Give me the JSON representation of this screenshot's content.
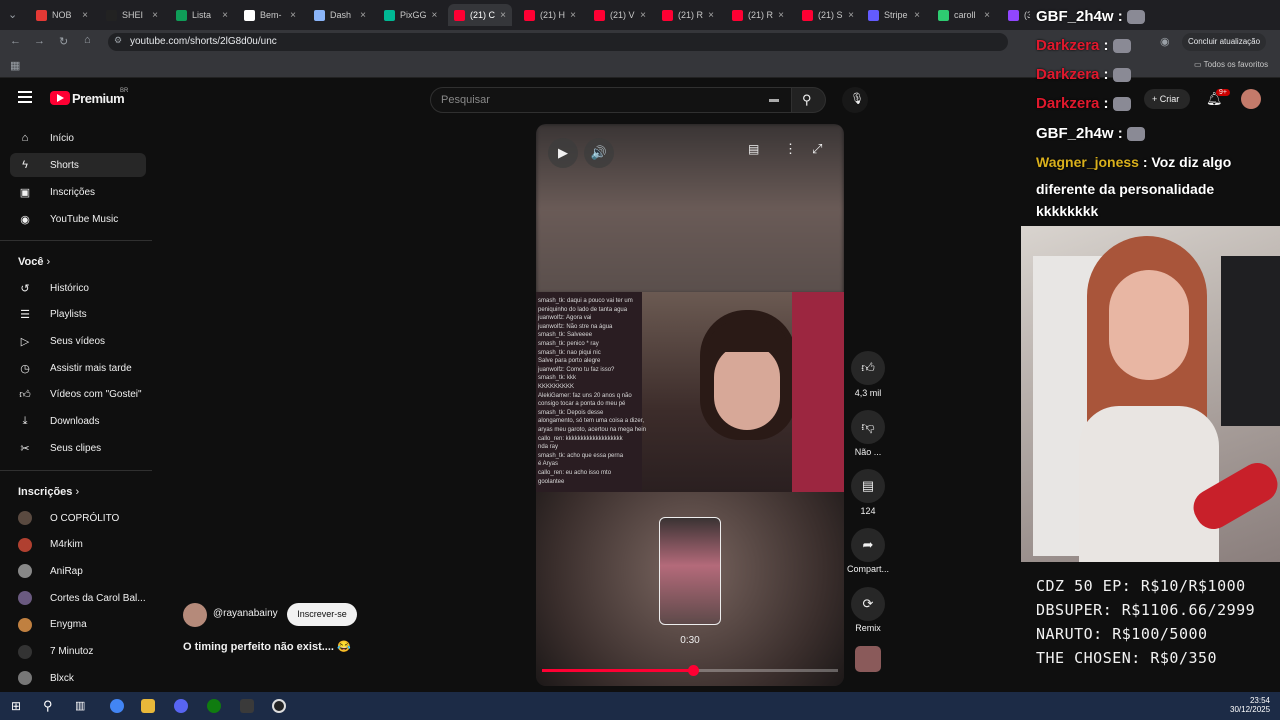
{
  "browser": {
    "tabs": [
      "NOB",
      "SHEI",
      "Lista",
      "Bem-",
      "Dash",
      "PixGG",
      "(21) C",
      "(21) H",
      "(21) V",
      "(21) R",
      "(21) R",
      "(21) S",
      "Stripe",
      "caroll",
      "(3) c"
    ],
    "url": "youtube.com/shorts/2lG8d0u/unc",
    "update_label": "Concluir atualização",
    "favorites_label": "Todos os favoritos"
  },
  "yt": {
    "logo": "Premium",
    "region": "BR",
    "search_placeholder": "Pesquisar",
    "create_label": "Criar",
    "notif_count": "9+"
  },
  "sidebar": {
    "main": [
      {
        "label": "Início",
        "icon": "home-icon"
      },
      {
        "label": "Shorts",
        "icon": "shorts-icon"
      },
      {
        "label": "Inscrições",
        "icon": "subscriptions-icon"
      },
      {
        "label": "YouTube Music",
        "icon": "music-icon"
      }
    ],
    "you_title": "Você",
    "you": [
      {
        "label": "Histórico",
        "icon": "history-icon"
      },
      {
        "label": "Playlists",
        "icon": "playlist-icon"
      },
      {
        "label": "Seus vídeos",
        "icon": "video-icon"
      },
      {
        "label": "Assistir mais tarde",
        "icon": "watch-later-icon"
      },
      {
        "label": "Vídeos com \"Gostei\"",
        "icon": "like-icon"
      },
      {
        "label": "Downloads",
        "icon": "download-icon"
      },
      {
        "label": "Seus clipes",
        "icon": "scissors-icon"
      }
    ],
    "subs_title": "Inscrições",
    "subs": [
      "O COPRÓLITO",
      "M4rkim",
      "AniRap",
      "Cortes da Carol Bal...",
      "Enygma",
      "7 Minutoz",
      "Blxck"
    ]
  },
  "short": {
    "channel": "@rayanabainy",
    "subscribe": "Inscrever-se",
    "title": "O timing perfeito não exist.... 😂",
    "thumb_time": "0:30",
    "progress_fraction": 0.51,
    "likes": "4,3 mil",
    "dislike_label": "Não ...",
    "comments": "124",
    "share_label": "Compart...",
    "remix_label": "Remix"
  },
  "chat_in_video": [
    "smash_tk: daqui a pouco vai ter um",
    "peniquinho do lado de tanta agua",
    "juanwolfz: Agora vai",
    "juanwolfz: Não stre na água",
    "smash_tk: Salveeee",
    "smash_tk: penico * ray",
    "smash_tk: nao piqui nic",
    "Salve para porto alegre",
    "juanwolfz: Como tu faz isso?",
    "smash_tk: kkk",
    "KKKKKKKKK",
    "AlekiGamer: faz uns 20 anos q não",
    "consigo tocar a ponta do meu pé",
    "smash_tk: Depois desse",
    "alongamento, só tem uma coisa a dizer,",
    "aryas meu garoto, acertou na mega hein",
    "callo_ren: kkkkkkkkkkkkkkkkkkk",
    "nda ray",
    "smash_tk: acho que essa perna",
    "é Aryas",
    "callo_ren: eu acho isso mto",
    "goolantee"
  ],
  "stream": {
    "chat": [
      {
        "user": "GBF_2h4w",
        "msg": "",
        "color": "#ffffff"
      },
      {
        "user": "Darkzera",
        "msg": "",
        "color": "#e0192d"
      },
      {
        "user": "Darkzera",
        "msg": "",
        "color": "#e0192d"
      },
      {
        "user": "Darkzera",
        "msg": "",
        "color": "#e0192d"
      },
      {
        "user": "GBF_2h4w",
        "msg": "",
        "color": "#ffffff"
      },
      {
        "user": "Wagner_joness",
        "msg": "Voz diz algo",
        "color": "#d9b01c"
      }
    ],
    "msg_cont1": "diferente da personalidade",
    "msg_cont2": "kkkkkkkk",
    "goals": [
      "CDZ 50 EP: R$10/R$1000",
      "DBSUPER: R$1106.66/2999",
      "NARUTO: R$100/5000",
      "THE CHOSEN: R$0/350"
    ]
  },
  "taskbar": {
    "time": "23:54",
    "date": "30/12/2025"
  }
}
